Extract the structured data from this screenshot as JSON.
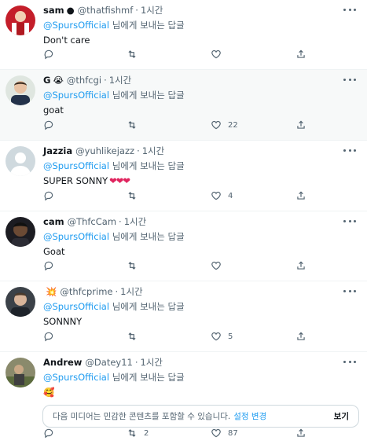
{
  "ui": {
    "reply_to_suffix": "님에게 보내는 답글",
    "more_label": "더 보기"
  },
  "tweets": [
    {
      "name": "sam",
      "name_emoji": "●",
      "handle": "@thatfishmf",
      "time": "1시간",
      "mention": "@SpursOfficial",
      "text": "Don't care",
      "replies": "",
      "retweets": "",
      "likes": ""
    },
    {
      "name": "G",
      "name_emoji": "😭",
      "handle": "@thfcgi",
      "time": "1시간",
      "mention": "@SpursOfficial",
      "text": "goat",
      "replies": "",
      "retweets": "",
      "likes": "22"
    },
    {
      "name": "Jazzia",
      "name_emoji": "",
      "handle": "@yuhlikejazz",
      "time": "1시간",
      "mention": "@SpursOfficial",
      "text": "SUPER SONNY",
      "text_emoji": "❤❤❤",
      "replies": "",
      "retweets": "",
      "likes": "4"
    },
    {
      "name": "cam",
      "name_emoji": "",
      "handle": "@ThfcCam",
      "time": "1시간",
      "mention": "@SpursOfficial",
      "text": "Goat",
      "replies": "",
      "retweets": "",
      "likes": ""
    },
    {
      "name": "",
      "name_emoji": "💥",
      "handle": "@thfcprime",
      "time": "1시간",
      "mention": "@SpursOfficial",
      "text": "SONNNY",
      "replies": "",
      "retweets": "",
      "likes": "5"
    },
    {
      "name": "Andrew",
      "name_emoji": "",
      "handle": "@Datey11",
      "time": "1시간",
      "mention": "@SpursOfficial",
      "text": "🥰",
      "replies": "",
      "retweets": "2",
      "likes": "87"
    }
  ],
  "sensitive": {
    "text": "다음 미디어는 민감한 콘텐츠를 포함할 수 있습니다.",
    "link": "설정 변경",
    "view": "보기"
  },
  "colors": {
    "accent": "#1d9bf0",
    "muted": "#536471",
    "heart": "#e0245e",
    "border": "#eff3f4"
  },
  "icons": [
    "reply-icon",
    "retweet-icon",
    "like-icon",
    "share-icon",
    "more-icon"
  ]
}
